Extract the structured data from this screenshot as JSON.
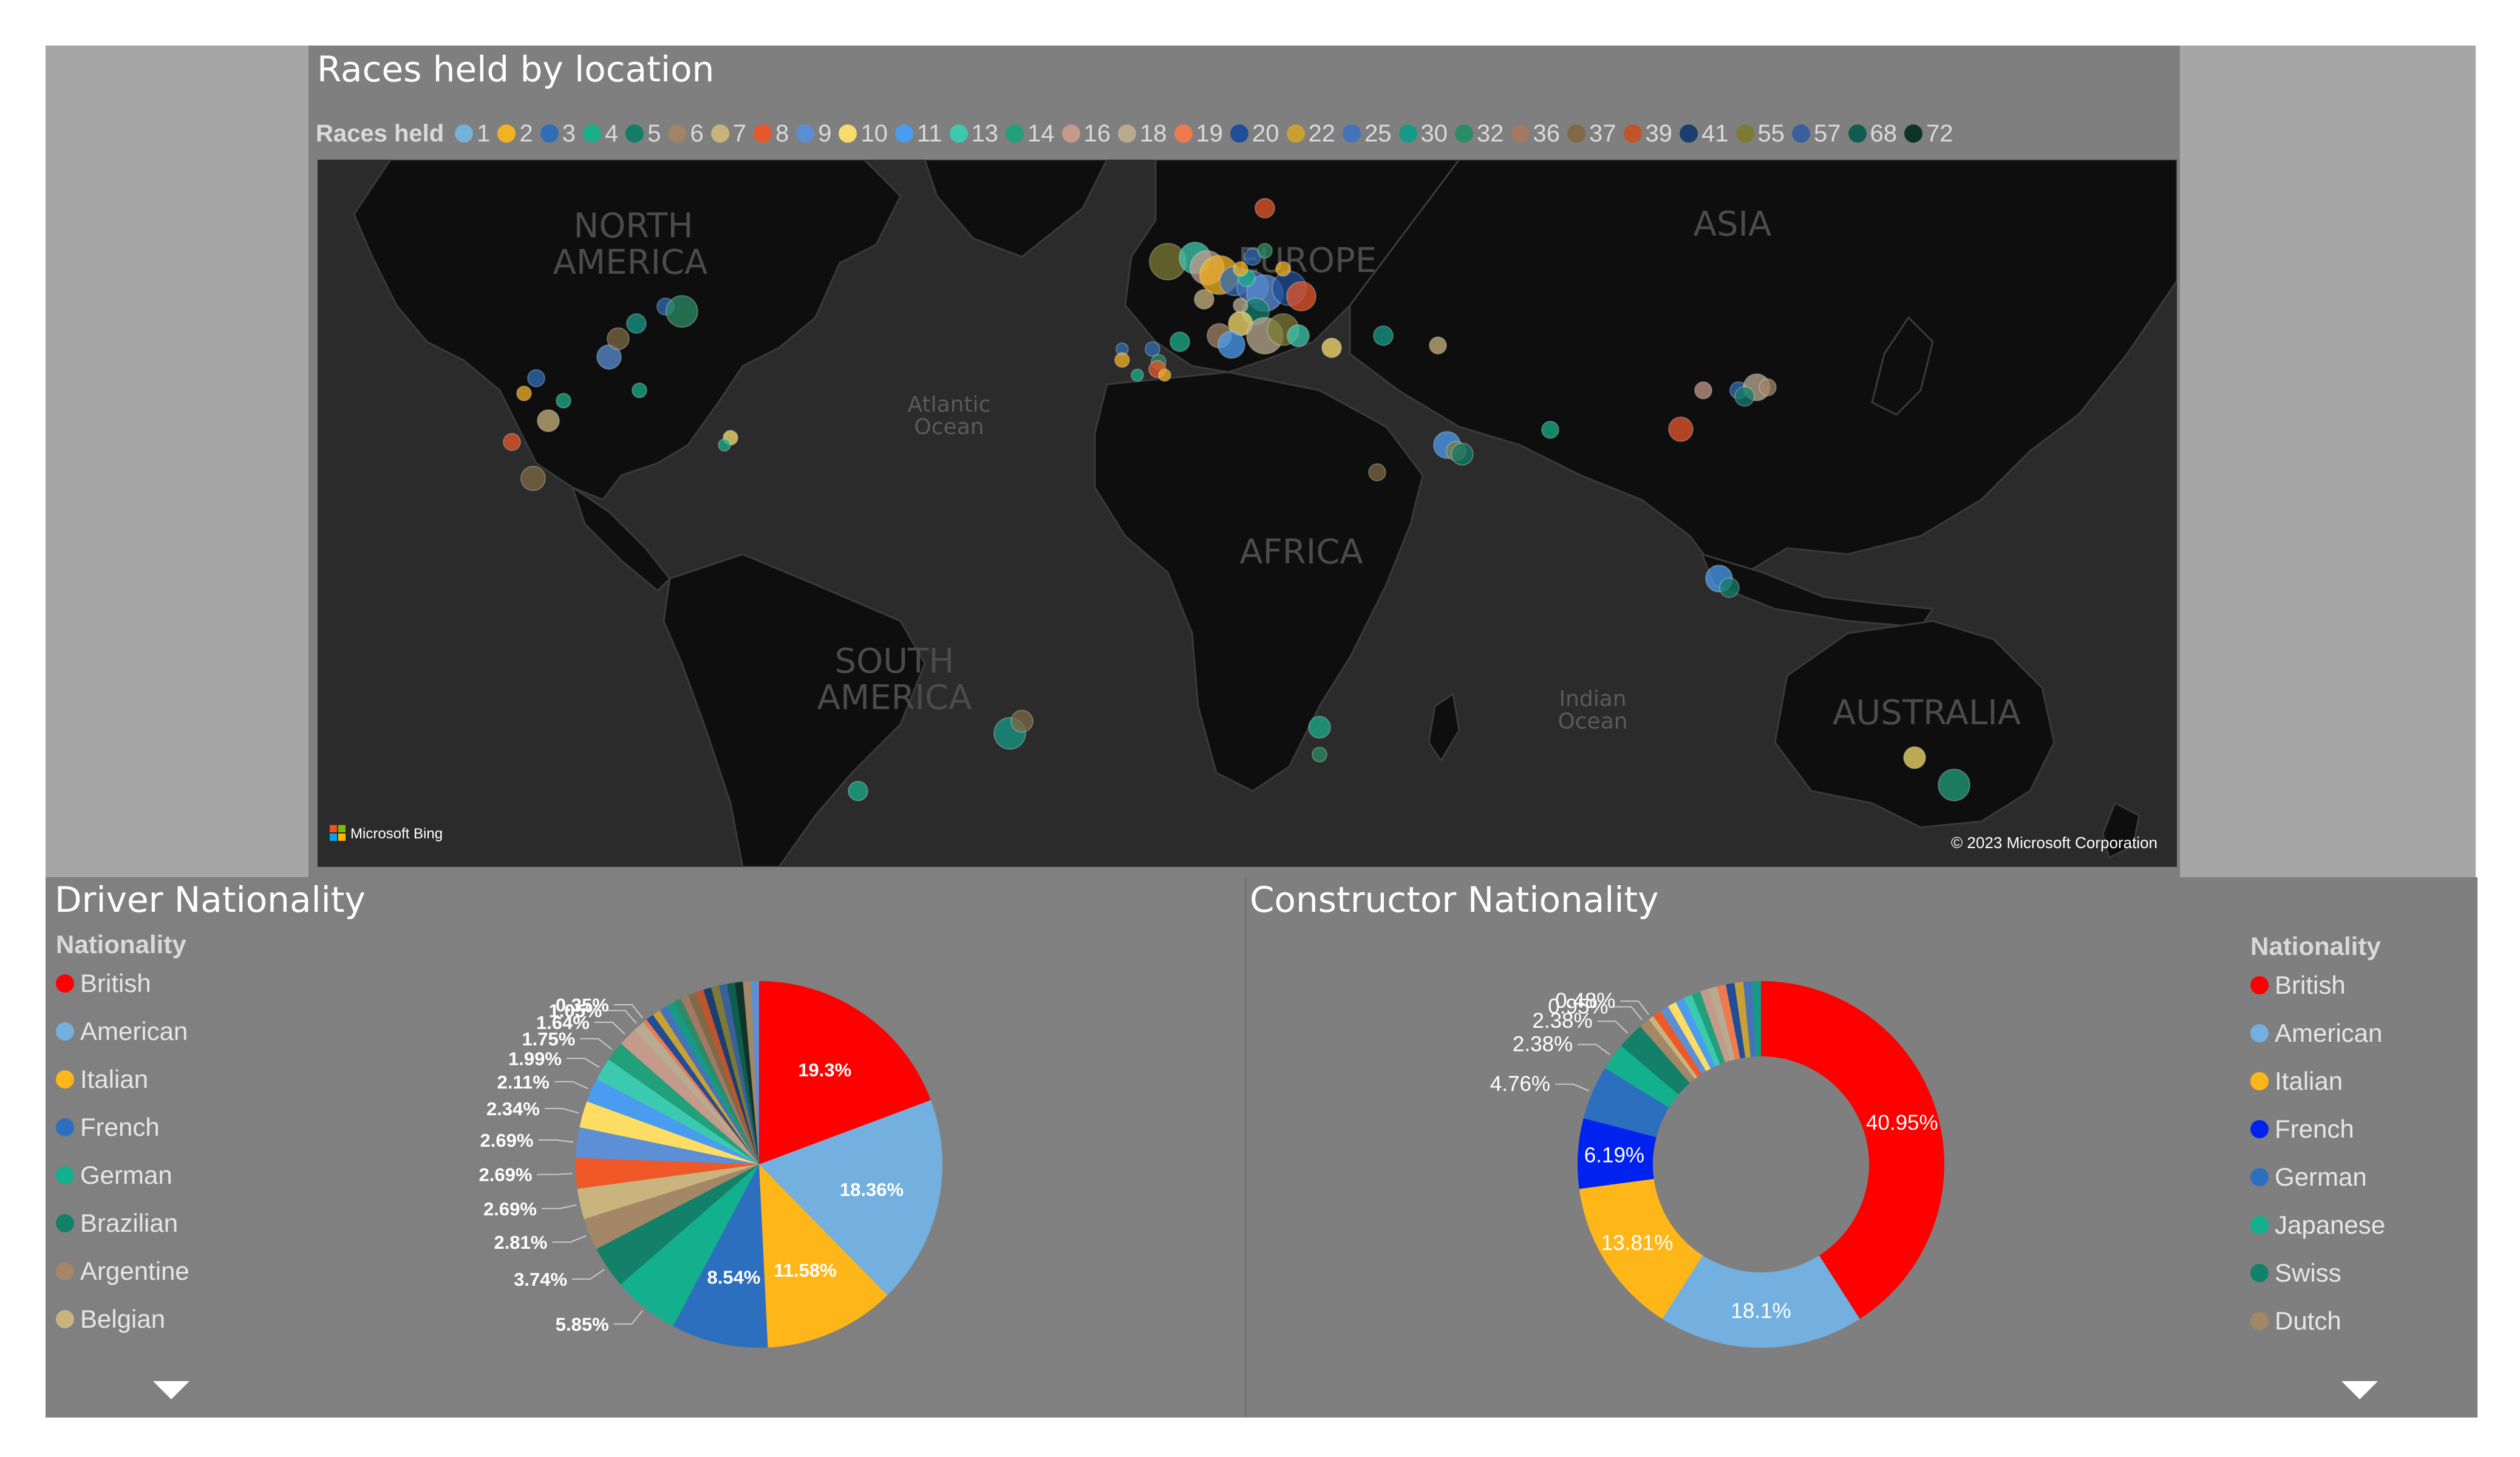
{
  "map": {
    "title": "Races held by location",
    "legend_title": "Races held",
    "legend_items": [
      {
        "label": "1",
        "color": "#76b1d9"
      },
      {
        "label": "2",
        "color": "#f2b323"
      },
      {
        "label": "3",
        "color": "#2f6eb5"
      },
      {
        "label": "4",
        "color": "#1aaf8b"
      },
      {
        "label": "5",
        "color": "#137d68"
      },
      {
        "label": "6",
        "color": "#a08465"
      },
      {
        "label": "7",
        "color": "#c8b37c"
      },
      {
        "label": "8",
        "color": "#e8572a"
      },
      {
        "label": "9",
        "color": "#5a8fd4"
      },
      {
        "label": "10",
        "color": "#f8dc6b"
      },
      {
        "label": "11",
        "color": "#4a9cf0"
      },
      {
        "label": "13",
        "color": "#3cc9b0"
      },
      {
        "label": "14",
        "color": "#21a079"
      },
      {
        "label": "16",
        "color": "#c49a8a"
      },
      {
        "label": "18",
        "color": "#b8ab90"
      },
      {
        "label": "19",
        "color": "#f07a50"
      },
      {
        "label": "20",
        "color": "#1f4e96"
      },
      {
        "label": "22",
        "color": "#c9a133"
      },
      {
        "label": "25",
        "color": "#4474b8"
      },
      {
        "label": "30",
        "color": "#169a88"
      },
      {
        "label": "32",
        "color": "#2b8c66"
      },
      {
        "label": "36",
        "color": "#a37865"
      },
      {
        "label": "37",
        "color": "#7e6a45"
      },
      {
        "label": "39",
        "color": "#c0542a"
      },
      {
        "label": "41",
        "color": "#1b3e70"
      },
      {
        "label": "55",
        "color": "#7c7a35"
      },
      {
        "label": "57",
        "color": "#3a5f9a"
      },
      {
        "label": "68",
        "color": "#0f5c50"
      },
      {
        "label": "72",
        "color": "#0f3326"
      }
    ],
    "continent_labels": [
      {
        "text": "NORTH AMERICA",
        "line1": "NORTH",
        "line2": "AMERICA"
      },
      {
        "text": "EUROPE",
        "line1": "EUROPE",
        "line2": ""
      },
      {
        "text": "ASIA",
        "line1": "ASIA",
        "line2": ""
      },
      {
        "text": "AFRICA",
        "line1": "AFRICA",
        "line2": ""
      },
      {
        "text": "SOUTH AMERICA",
        "line1": "SOUTH",
        "line2": "AMERICA"
      },
      {
        "text": "AUSTRALIA",
        "line1": "AUSTRALIA",
        "line2": ""
      }
    ],
    "ocean_labels": [
      {
        "line1": "Atlantic",
        "line2": "Ocean"
      },
      {
        "line1": "Indian",
        "line2": "Ocean"
      }
    ],
    "bing_text": "Microsoft Bing",
    "copyright": "© 2023 Microsoft Corporation"
  },
  "driver": {
    "title": "Driver Nationality",
    "legend_title": "Nationality",
    "legend_items": [
      {
        "label": "British",
        "color": "#ff0000"
      },
      {
        "label": "American",
        "color": "#73b0e0"
      },
      {
        "label": "Italian",
        "color": "#ffb619"
      },
      {
        "label": "French",
        "color": "#2d6fbf"
      },
      {
        "label": "German",
        "color": "#12b08c"
      },
      {
        "label": "Brazilian",
        "color": "#13806a"
      },
      {
        "label": "Argentine",
        "color": "#a38767"
      },
      {
        "label": "Belgian",
        "color": "#c9b47e"
      }
    ]
  },
  "constructor": {
    "title": "Constructor Nationality",
    "legend_title": "Nationality",
    "legend_items": [
      {
        "label": "British",
        "color": "#ff0000"
      },
      {
        "label": "American",
        "color": "#73b0e0"
      },
      {
        "label": "Italian",
        "color": "#ffb619"
      },
      {
        "label": "French",
        "color": "#0022ee"
      },
      {
        "label": "German",
        "color": "#2d6fbf"
      },
      {
        "label": "Japanese",
        "color": "#12b08c"
      },
      {
        "label": "Swiss",
        "color": "#13806a"
      },
      {
        "label": "Dutch",
        "color": "#a38767"
      }
    ]
  },
  "chart_data": [
    {
      "type": "pie",
      "title": "Driver Nationality",
      "legend_title": "Nationality",
      "values": [
        19.3,
        18.36,
        11.58,
        8.54,
        5.85,
        3.74,
        2.81,
        2.69,
        2.69,
        2.69,
        2.34,
        2.11,
        1.99,
        1.75,
        1.64,
        1.05,
        0.35
      ],
      "labels": [
        "19.3%",
        "18.36%",
        "11.58%",
        "8.54%",
        "5.85%",
        "3.74%",
        "2.81%",
        "2.69%",
        "2.69%",
        "2.69%",
        "2.34%",
        "2.11%",
        "1.99%",
        "1.75%",
        "1.64%",
        "1.05%",
        "0.35%"
      ],
      "colors": [
        "#ff0000",
        "#73b0e0",
        "#ffb619",
        "#2d6fbf",
        "#12b08c",
        "#13806a",
        "#a38767",
        "#c9b47e",
        "#f05828",
        "#5d8fd6",
        "#fddd63",
        "#4a9cf0",
        "#3bc9b0",
        "#21a079",
        "#c49a8a",
        "#b8ab90",
        "#f07a50"
      ],
      "remainder_colors": [
        "#1f4e96",
        "#c9a133",
        "#4474b8",
        "#169a88",
        "#2b8c66",
        "#a37865",
        "#7e6a45",
        "#c0542a",
        "#1b3e70",
        "#7c7a35",
        "#3a5f9a",
        "#0f5c50",
        "#0f3326",
        "#a38767",
        "#5d8fd6"
      ]
    },
    {
      "type": "donut",
      "title": "Constructor Nationality",
      "legend_title": "Nationality",
      "values": [
        40.95,
        18.1,
        13.81,
        6.19,
        4.76,
        2.38,
        2.38,
        0.95,
        0.48
      ],
      "labels": [
        "40.95%",
        "18.1%",
        "13.81%",
        "6.19%",
        "4.76%",
        "2.38%",
        "2.38%",
        "0.95%",
        "0.48%"
      ],
      "colors": [
        "#ff0000",
        "#73b0e0",
        "#ffb619",
        "#0022ee",
        "#2d6fbf",
        "#12b08c",
        "#13806a",
        "#a38767",
        "#c9b47e"
      ],
      "remainder_colors": [
        "#f05828",
        "#5d8fd6",
        "#fddd63",
        "#4a9cf0",
        "#3bc9b0",
        "#21a079",
        "#c49a8a",
        "#b8ab90",
        "#f07a50",
        "#1f4e96",
        "#c9a133",
        "#4474b8",
        "#169a88"
      ]
    }
  ]
}
